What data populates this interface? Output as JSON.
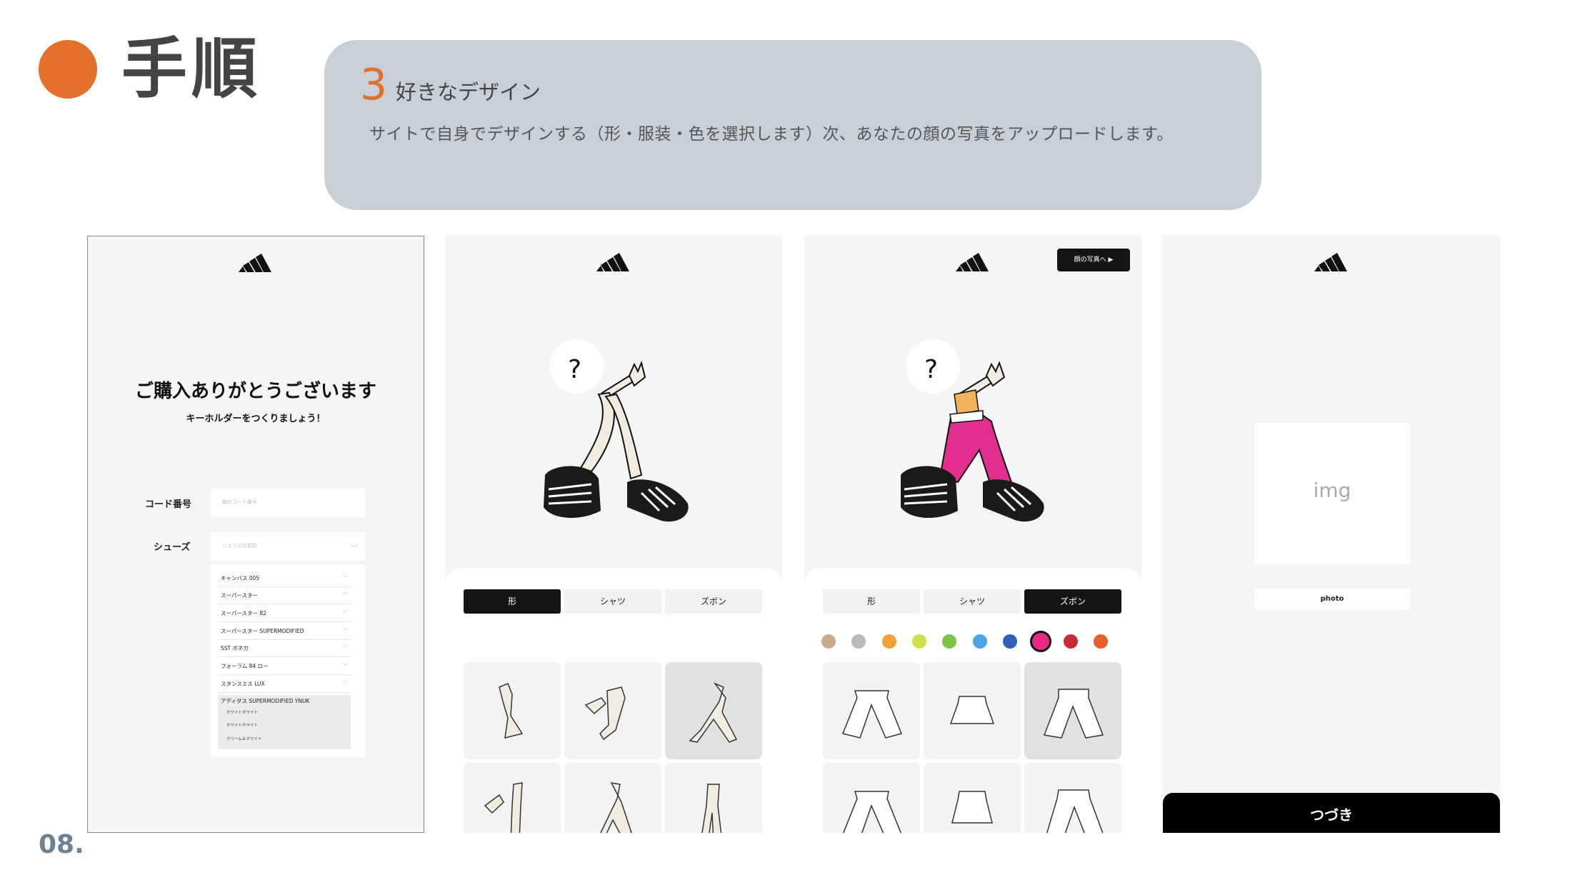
{
  "header": {
    "title": "手順",
    "page_number": "08.",
    "accent_color": "#e36f2c"
  },
  "step": {
    "number": "3",
    "title": "好きなデザイン",
    "description": "サイトで自身でデザインする（形・服装・色を選択します）次、あなたの顔の写真をアップロードします。"
  },
  "screen1": {
    "logo": "adidas-logo-icon",
    "heading": "ご購入ありがとうございます",
    "subheading": "キーホルダーをつくりましょう！",
    "code_label": "コード番号",
    "code_placeholder": "箱のコード番号",
    "shoes_label": "シューズ",
    "shoes_placeholder": "シューズの名前",
    "options": [
      "キャンバス 005",
      "スーパースター",
      "スーパースター 82",
      "スーパースター SUPERMODIFIED",
      "SST ボネガ",
      "フォーラム 84 ロー",
      "スタンスミス LUX"
    ],
    "group": {
      "title": "アディダス SUPERMODIFIED YNUK",
      "items": [
        "ホワイトホワイト",
        "ホワイトホワイト",
        "クリーム＆ホワイト"
      ]
    }
  },
  "screen2": {
    "tabs": [
      "形",
      "シャツ",
      "ズボン"
    ],
    "active_tab": "形"
  },
  "screen3": {
    "face_button": "顔の写真へ ▶",
    "tabs": [
      "形",
      "シャツ",
      "ズボン"
    ],
    "active_tab": "ズボン",
    "swatches": [
      "#c8a98a",
      "#b9b9b9",
      "#f0a13a",
      "#cfe04a",
      "#7cc447",
      "#4aa4e3",
      "#2f5fb8",
      "#e82a84",
      "#c62b33",
      "#e85f2a"
    ],
    "selected_swatch": "#e82a84"
  },
  "screen4": {
    "img_placeholder": "img",
    "photo_button": "photo",
    "next_button": "つづき"
  }
}
